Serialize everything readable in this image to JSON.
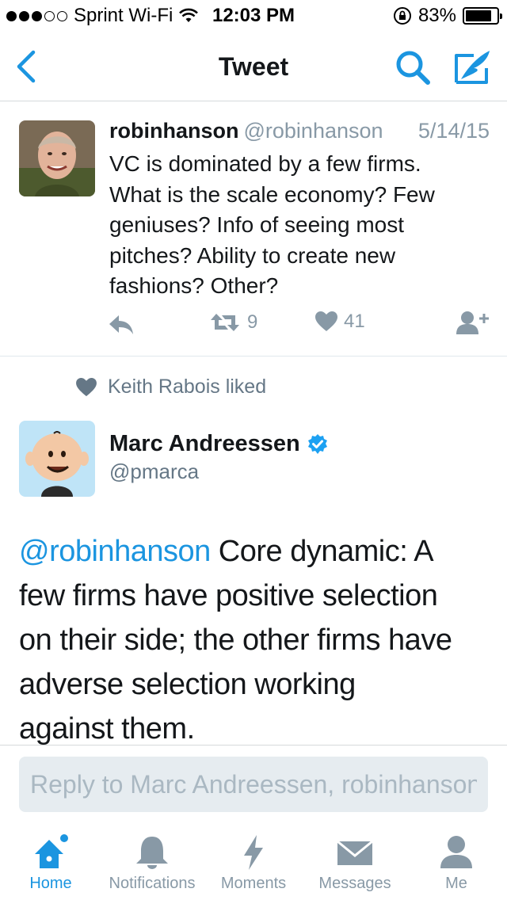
{
  "status_bar": {
    "carrier": "Sprint Wi-Fi",
    "time": "12:03 PM",
    "battery": "83%",
    "battery_level": 0.83
  },
  "nav": {
    "title": "Tweet",
    "icons": [
      "back-chevron-icon",
      "search-icon",
      "compose-quill-icon"
    ],
    "accent": "#1b95e0"
  },
  "tweet": {
    "name": "robinhanson",
    "handle": "@robinhanson",
    "date": "5/14/15",
    "lines": [
      "VC is dominated by a few firms.",
      "What is the scale economy? Few",
      "geniuses? Info of seeing most",
      "pitches? Ability to create new",
      "fashions? Other?"
    ],
    "retweets": "9",
    "likes": "41"
  },
  "liked_by": "Keith Rabois liked",
  "reply_tweet": {
    "name": "Marc Andreessen",
    "handle": "@pmarca",
    "mention": "@robinhanson",
    "lines": [
      " Core dynamic: A",
      "few firms have positive selection",
      "on their side; the other firms have",
      "adverse selection working",
      "against them."
    ]
  },
  "reply_box": {
    "placeholder": "Reply to Marc Andreessen, robinhanson"
  },
  "tabs": [
    {
      "label": "Home",
      "icon": "home-icon"
    },
    {
      "label": "Notifications",
      "icon": "bell-icon"
    },
    {
      "label": "Moments",
      "icon": "lightning-icon"
    },
    {
      "label": "Messages",
      "icon": "envelope-icon"
    },
    {
      "label": "Me",
      "icon": "person-icon"
    }
  ],
  "colors": {
    "accent": "#1b95e0",
    "muted": "#8899a6",
    "verified": "#1da1f2"
  }
}
